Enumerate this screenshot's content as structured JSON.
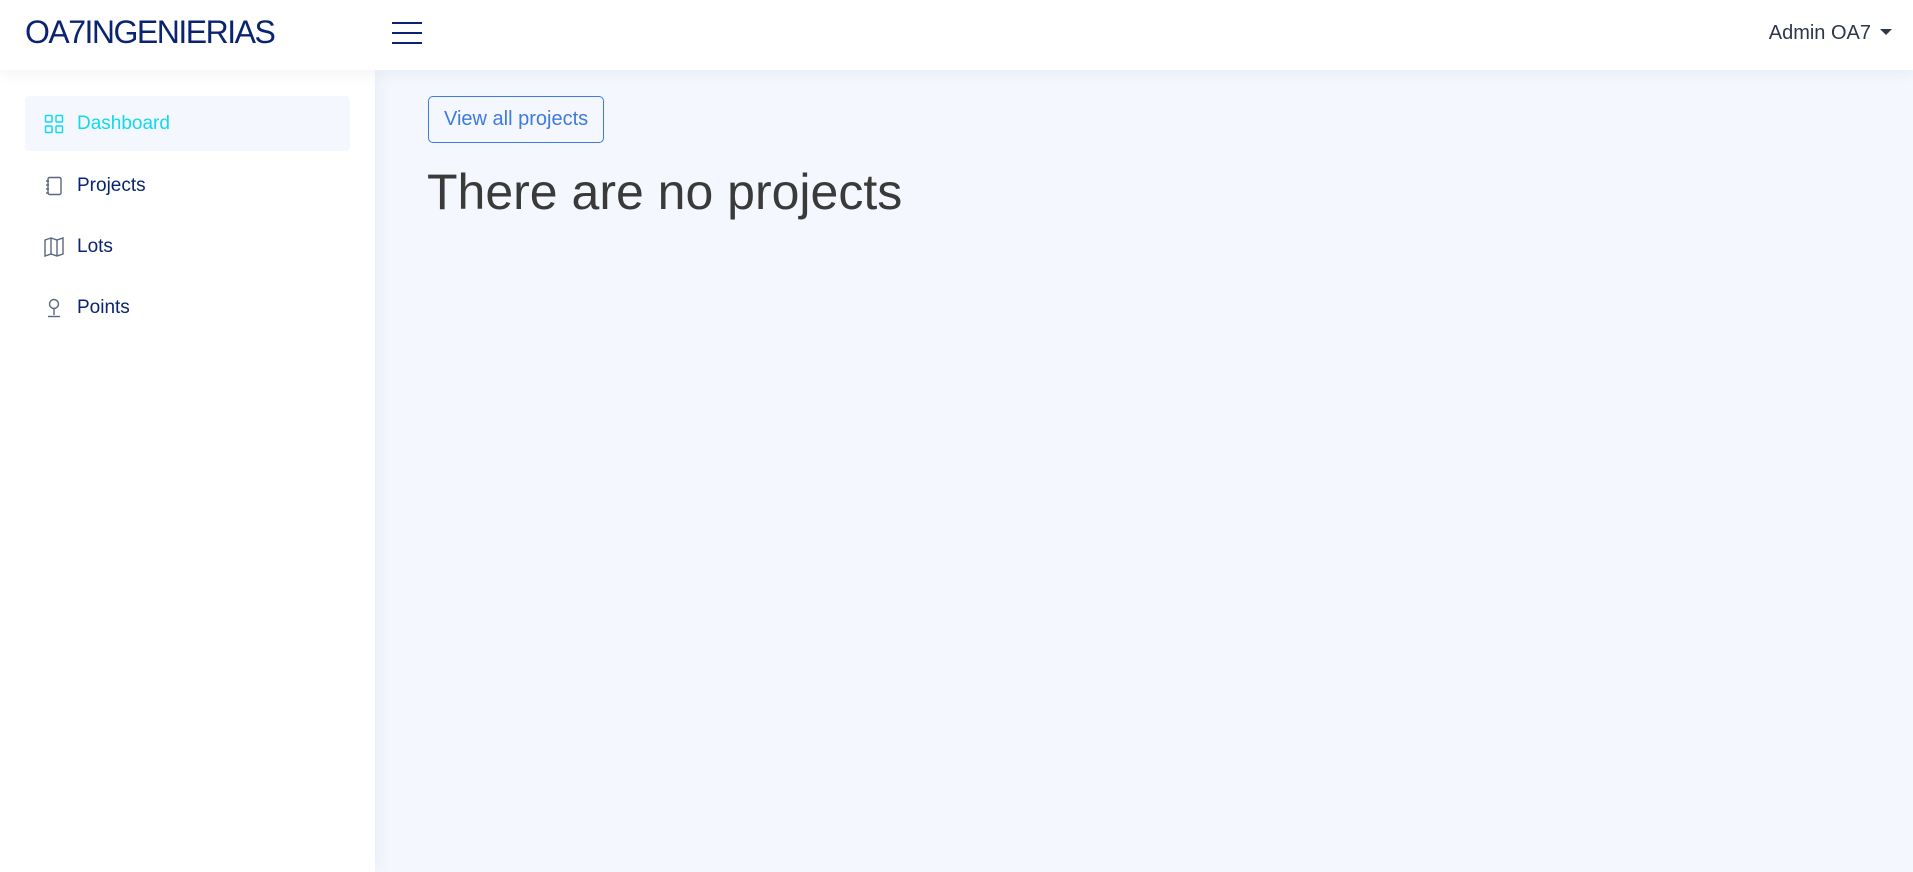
{
  "header": {
    "brand": "OA7INGENIERIAS",
    "menu_icon": "hamburger-icon",
    "user_name": "Admin OA7",
    "user_caret_icon": "caret-down-icon"
  },
  "sidebar": {
    "items": [
      {
        "label": "Dashboard",
        "icon": "grid-icon",
        "active": true
      },
      {
        "label": "Projects",
        "icon": "notebook-icon",
        "active": false
      },
      {
        "label": "Lots",
        "icon": "map-icon",
        "active": false
      },
      {
        "label": "Points",
        "icon": "pin-icon",
        "active": false
      }
    ]
  },
  "main": {
    "view_all_label": "View all projects",
    "empty_message": "There are no projects"
  },
  "colors": {
    "brand": "#0a2472",
    "accent_active": "#10d9f0",
    "button_border": "#3e7bdc",
    "page_background": "#f4f7fd"
  }
}
